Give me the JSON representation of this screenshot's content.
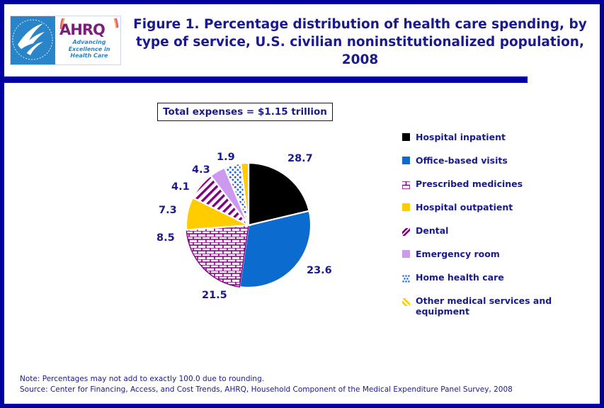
{
  "figure": {
    "title": "Figure 1. Percentage distribution of health care spending, by type of service, U.S. civilian noninstitutionalized population, 2008",
    "total_label": "Total expenses = $1.15 trillion"
  },
  "logo": {
    "agency_initials": "AHRQ",
    "tagline_line1": "Advancing",
    "tagline_line2": "Excellence in",
    "tagline_line3": "Health Care",
    "seal_name": "hhs-seal",
    "seal_bg": "#2a84c8",
    "wordmark_color": "#7b1f78",
    "tagline_color": "#2a84c8"
  },
  "footer": {
    "note": "Note: Percentages may not add to exactly 100.0 due to rounding.",
    "source": "Source: Center for Financing, Access, and Cost Trends, AHRQ, Household Component of the Medical Expenditure Panel Survey, 2008"
  },
  "colors": {
    "frame": "#0000A0",
    "rule_bar": "#0000A0",
    "text_navy": "#1a1a8c",
    "black": "#000000",
    "blue": "#0B6BCE",
    "purple": "#800080",
    "gold": "#FFCC00",
    "lavender": "#CC99EE",
    "white": "#FFFFFF"
  },
  "chart_data": {
    "type": "pie",
    "title": "Figure 1. Percentage distribution of health care spending, by type of service, U.S. civilian noninstitutionalized population, 2008",
    "subtitle": "Total expenses = $1.15 trillion",
    "unit": "percent",
    "legend_position": "right",
    "total": 99.9,
    "categories": [
      "Hospital inpatient",
      "Office-based visits",
      "Prescribed medicines",
      "Hospital outpatient",
      "Dental",
      "Emergency room",
      "Home health care",
      "Other medical services and equipment"
    ],
    "values": [
      28.7,
      23.6,
      21.5,
      8.5,
      7.3,
      4.1,
      4.3,
      1.9
    ],
    "slices": [
      {
        "label": "Hospital inpatient",
        "value": 28.7,
        "fill": "#000000",
        "pattern": "solid"
      },
      {
        "label": "Office-based visits",
        "value": 23.6,
        "fill": "#0B6BCE",
        "pattern": "solid"
      },
      {
        "label": "Prescribed medicines",
        "value": 21.5,
        "fill": "#800080",
        "pattern": "brick"
      },
      {
        "label": "Hospital outpatient",
        "value": 8.5,
        "fill": "#FFCC00",
        "pattern": "solid"
      },
      {
        "label": "Dental",
        "value": 7.3,
        "fill": "#800080",
        "pattern": "diagonal-stripes"
      },
      {
        "label": "Emergency room",
        "value": 4.1,
        "fill": "#CC99EE",
        "pattern": "solid"
      },
      {
        "label": "Home health care",
        "value": 4.3,
        "fill": "#1560D8",
        "pattern": "dots"
      },
      {
        "label": "Other medical services and equipment",
        "value": 1.9,
        "fill": "#FFCC00",
        "pattern": "solid"
      }
    ]
  },
  "legend": {
    "items": [
      {
        "label": "Hospital inpatient",
        "marker": "solid-black-swatch"
      },
      {
        "label": "Office-based visits",
        "marker": "solid-blue-swatch"
      },
      {
        "label": "Prescribed medicines",
        "marker": "brick-pattern-swatch"
      },
      {
        "label": "Hospital outpatient",
        "marker": "solid-gold-swatch"
      },
      {
        "label": "Dental",
        "marker": "diagonal-stripe-swatch"
      },
      {
        "label": "Emergency room",
        "marker": "solid-lavender-swatch"
      },
      {
        "label": "Home health care",
        "marker": "dotted-blue-swatch"
      },
      {
        "label": "Other medical services and equipment",
        "marker": "yellow-diagonal-swatch"
      }
    ]
  },
  "data_labels": [
    {
      "text": "28.7",
      "slice": "Hospital inpatient"
    },
    {
      "text": "23.6",
      "slice": "Office-based visits"
    },
    {
      "text": "21.5",
      "slice": "Prescribed medicines"
    },
    {
      "text": "8.5",
      "slice": "Hospital outpatient"
    },
    {
      "text": "7.3",
      "slice": "Dental"
    },
    {
      "text": "4.1",
      "slice": "Emergency room"
    },
    {
      "text": "4.3",
      "slice": "Home health care"
    },
    {
      "text": "1.9",
      "slice": "Other medical services and equipment"
    }
  ]
}
